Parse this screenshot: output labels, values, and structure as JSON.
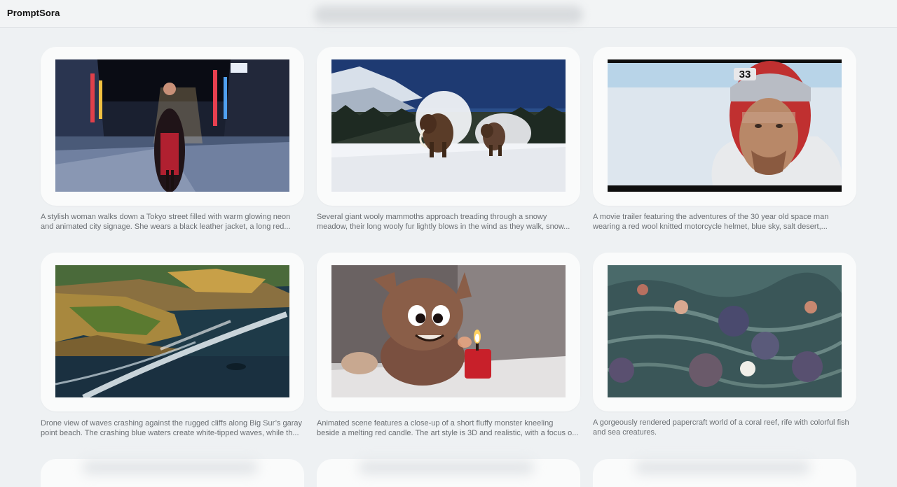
{
  "app": {
    "title": "PromptSora"
  },
  "videos": [
    {
      "caption_line1": "A stylish woman walks down a Tokyo street filled with warm glowing neon",
      "caption_line2": "and animated city signage. She wears a black leather jacket, a long red...",
      "thumb_icon": "tokyo-street-thumbnail"
    },
    {
      "caption_line1": "Several giant wooly mammoths approach treading through a snowy",
      "caption_line2": "meadow, their long wooly fur lightly blows in the wind as they walk, snow...",
      "thumb_icon": "mammoths-thumbnail"
    },
    {
      "caption_line1": "A movie trailer featuring the adventures of the 30 year old space man",
      "caption_line2": "wearing a red wool knitted motorcycle helmet, blue sky, salt desert,...",
      "thumb_icon": "spaceman-thumbnail",
      "helmet_number": "33"
    },
    {
      "caption_line1": "Drone view of waves crashing against the rugged cliffs along Big Sur’s garay",
      "caption_line2": "point beach. The crashing blue waters create white-tipped waves, while th...",
      "thumb_icon": "big-sur-cliffs-thumbnail"
    },
    {
      "caption_line1": "Animated scene features a close-up of a short fluffy monster kneeling",
      "caption_line2": "beside a melting red candle. The art style is 3D and realistic, with a focus o...",
      "thumb_icon": "fluffy-monster-thumbnail"
    },
    {
      "caption_line1": "A gorgeously rendered papercraft world of a coral reef, rife with colorful fish",
      "caption_line2": "and sea creatures.",
      "thumb_icon": "papercraft-reef-thumbnail"
    }
  ]
}
